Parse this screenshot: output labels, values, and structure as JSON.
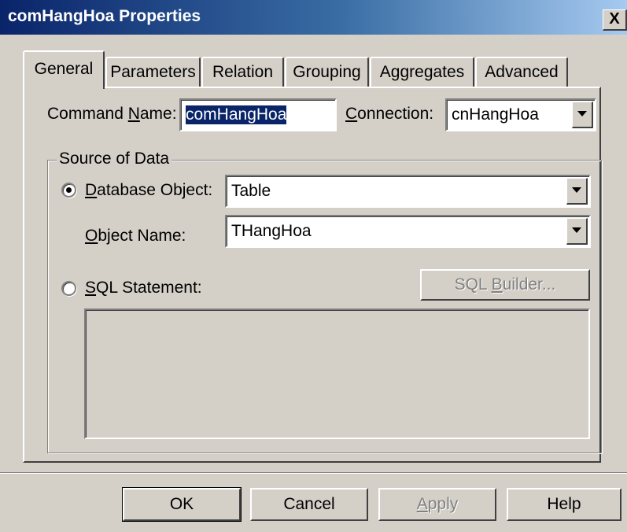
{
  "window": {
    "title": "comHangHoa Properties",
    "close_label": "X"
  },
  "tabs": [
    {
      "label": "General",
      "active": true
    },
    {
      "label": "Parameters",
      "active": false
    },
    {
      "label": "Relation",
      "active": false
    },
    {
      "label": "Grouping",
      "active": false
    },
    {
      "label": "Aggregates",
      "active": false
    },
    {
      "label": "Advanced",
      "active": false
    }
  ],
  "general": {
    "command_name_label_pre": "Command ",
    "command_name_label_ul": "N",
    "command_name_label_post": "ame:",
    "command_name_value": "comHangHoa",
    "connection_label_ul": "C",
    "connection_label_post": "onnection:",
    "connection_value": "cnHangHoa"
  },
  "source": {
    "legend": "Source of Data",
    "db_object_label_ul": "D",
    "db_object_label_post": "atabase Object:",
    "db_object_value": "Table",
    "db_object_selected": true,
    "object_name_label_ul": "O",
    "object_name_label_post": "bject Name:",
    "object_name_value": "THangHoa",
    "sql_label_ul": "S",
    "sql_label_post": "QL Statement:",
    "sql_selected": false,
    "sql_builder_pre": "SQL ",
    "sql_builder_ul": "B",
    "sql_builder_post": "uilder...",
    "sql_text": ""
  },
  "buttons": {
    "ok": "OK",
    "cancel": "Cancel",
    "apply_ul": "A",
    "apply_post": "pply",
    "help": "Help"
  },
  "colors": {
    "titlebar_start": "#0a246a",
    "titlebar_end": "#a6caf0",
    "face": "#d4d0c8",
    "selection": "#0a246a"
  }
}
